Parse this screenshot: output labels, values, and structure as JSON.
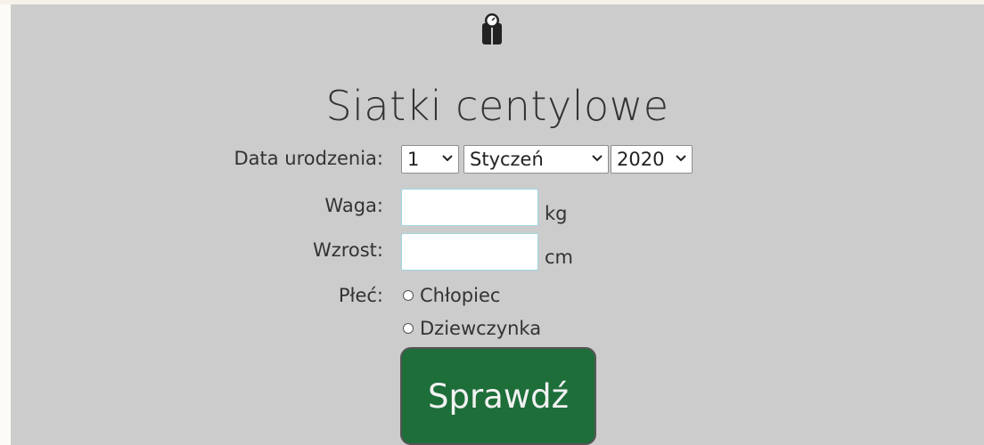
{
  "header": {
    "icon": "bathroom-scale-icon",
    "title": "Siatki centylowe"
  },
  "form": {
    "birthdate_label": "Data urodzenia:",
    "day_value": "1",
    "month_value": "Styczeń",
    "year_value": "2020",
    "weight_label": "Waga:",
    "weight_value": "",
    "weight_unit": "kg",
    "height_label": "Wzrost:",
    "height_value": "",
    "height_unit": "cm",
    "sex_label": "Płeć:",
    "sex_options": [
      "Chłopiec",
      "Dziewczynka"
    ],
    "submit_label": "Sprawdź"
  },
  "colors": {
    "panel_bg": "#cccccc",
    "submit_bg": "#1e6e3a",
    "input_border": "#9fd6e3"
  }
}
